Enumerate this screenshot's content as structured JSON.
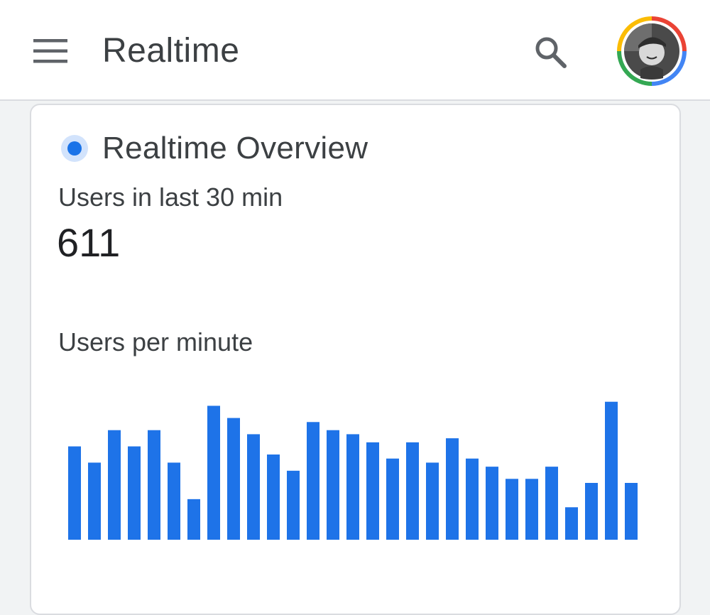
{
  "appbar": {
    "title": "Realtime",
    "menu_icon": "hamburger-menu-icon",
    "search_icon": "search-icon",
    "avatar_icon": "account-avatar"
  },
  "card": {
    "title": "Realtime Overview",
    "live_indicator_icon": "live-dot-icon",
    "metric_label": "Users in last 30 min",
    "metric_value": "611",
    "chart_label": "Users per minute"
  },
  "colors": {
    "accent": "#1a73e8",
    "bar": "#1e73e8",
    "title_text": "#3c4043",
    "background": "#f1f3f4"
  },
  "chart_data": {
    "type": "bar",
    "title": "Users per minute",
    "xlabel": "",
    "ylabel": "",
    "ylim": [
      0,
      35
    ],
    "grid": false,
    "values": [
      23,
      19,
      27,
      23,
      27,
      19,
      10,
      33,
      30,
      26,
      21,
      17,
      29,
      27,
      26,
      24,
      20,
      24,
      19,
      25,
      20,
      18,
      15,
      15,
      18,
      8,
      14,
      34,
      14
    ]
  }
}
